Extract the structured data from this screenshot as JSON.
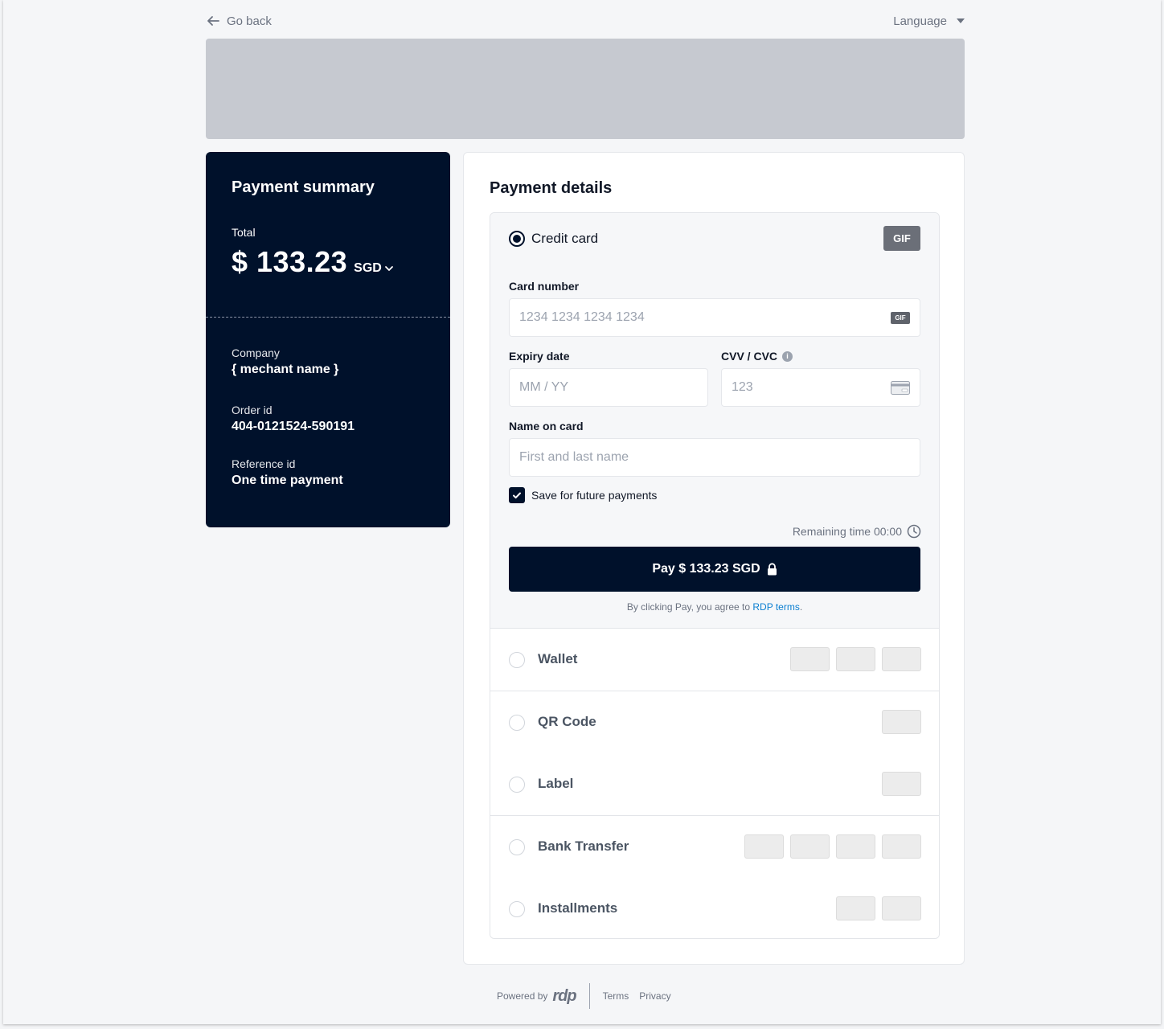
{
  "topbar": {
    "go_back": "Go back",
    "language": "Language"
  },
  "summary": {
    "title": "Payment summary",
    "total_label": "Total",
    "total_amount": "$ 133.23",
    "currency": "SGD",
    "company_label": "Company",
    "company_value": "{ mechant name }",
    "order_label": "Order id",
    "order_value": "404-0121524-590191",
    "reference_label": "Reference id",
    "reference_value": "One time payment"
  },
  "details": {
    "title": "Payment details",
    "credit_card": {
      "label": "Credit card",
      "badge": "GIF",
      "card_number_label": "Card number",
      "card_number_placeholder": "1234 1234 1234 1234",
      "card_badge": "GIF",
      "expiry_label": "Expiry date",
      "expiry_placeholder": "MM / YY",
      "cvv_label": "CVV / CVC",
      "cvv_placeholder": "123",
      "name_label": "Name on card",
      "name_placeholder": "First and last name",
      "save_label": "Save for future payments",
      "save_checked": true,
      "remaining": "Remaining time 00:00",
      "pay_label": "Pay $ 133.23 SGD",
      "agree_text": "By clicking Pay, you agree to",
      "agree_link": "RDP terms",
      "agree_end": "."
    },
    "methods": [
      {
        "label": "Wallet",
        "logos": 3
      },
      {
        "label": "QR Code",
        "logos": 1
      },
      {
        "label": "Label",
        "logos": 1
      },
      {
        "label": "Bank Transfer",
        "logos": 4
      },
      {
        "label": "Installments",
        "logos": 2
      }
    ]
  },
  "footer": {
    "powered_by": "Powered by",
    "brand": "rdp",
    "terms": "Terms",
    "privacy": "Privacy"
  },
  "colors": {
    "primary": "#00112b",
    "link": "#0b7fd1",
    "banner": "#c6c9d0"
  }
}
